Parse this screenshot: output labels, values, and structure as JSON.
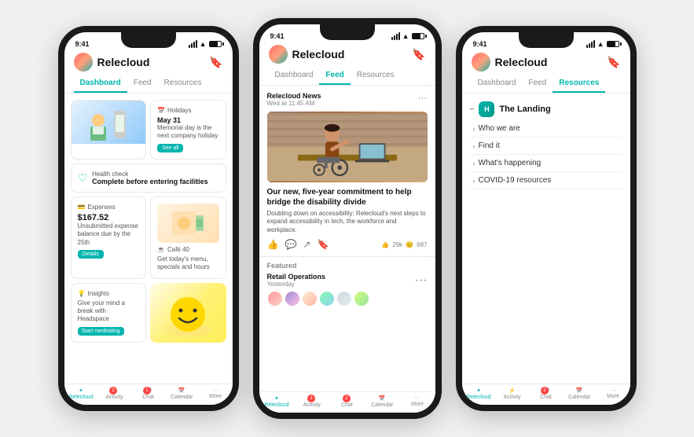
{
  "phones": [
    {
      "id": "dashboard",
      "statusBar": {
        "time": "9:41"
      },
      "header": {
        "title": "Relecloud",
        "bookmarkIcon": "🔖"
      },
      "tabs": [
        {
          "label": "Dashboard",
          "active": true
        },
        {
          "label": "Feed",
          "active": false
        },
        {
          "label": "Resources",
          "active": false
        }
      ],
      "cards": [
        {
          "type": "holiday",
          "label": "Holidays",
          "date": "May 31",
          "title": "Memorial day is the next company holiday",
          "buttonLabel": "See all"
        },
        {
          "type": "health",
          "label": "Health check",
          "title": "Complete before entering facilities"
        },
        {
          "type": "expenses",
          "label": "Expenses",
          "amount": "$167.52",
          "desc": "Unsubmitted expense balance due by the 25th",
          "buttonLabel": "Details"
        },
        {
          "type": "cafe",
          "label": "Café 40",
          "desc": "Get today's menu, specials and hours"
        },
        {
          "type": "insights",
          "label": "Insights",
          "desc": "Give your mind a break with Headspace",
          "buttonLabel": "Start meditating"
        }
      ],
      "bottomNav": [
        {
          "label": "Relecloud",
          "icon": "⚙",
          "active": true,
          "badge": null
        },
        {
          "label": "Activity",
          "icon": "⚡",
          "active": false,
          "badge": "2"
        },
        {
          "label": "Chat",
          "icon": "💬",
          "active": false,
          "badge": "1"
        },
        {
          "label": "Calendar",
          "icon": "📅",
          "active": false,
          "badge": null
        },
        {
          "label": "More",
          "icon": "•••",
          "active": false,
          "badge": null
        }
      ]
    },
    {
      "id": "feed",
      "statusBar": {
        "time": "9:41"
      },
      "header": {
        "title": "Relecloud",
        "bookmarkIcon": "🔖"
      },
      "tabs": [
        {
          "label": "Dashboard",
          "active": false
        },
        {
          "label": "Feed",
          "active": true
        },
        {
          "label": "Resources",
          "active": false
        }
      ],
      "post": {
        "source": "Relecloud News",
        "time": "Wed at 11:45 AM",
        "title": "Our new, five-year commitment to help bridge the disability divide",
        "desc": "Doubling down on accessibility: Relecloud's next steps to expand accessibility in tech, the workforce and workplace.",
        "likes": "29k",
        "comments": "687"
      },
      "featured": {
        "label": "Featured",
        "name": "Retail Operations",
        "time": "Yesterday",
        "avatars": [
          "av1",
          "av2",
          "av3",
          "av4",
          "av5",
          "av6"
        ]
      },
      "bottomNav": [
        {
          "label": "Relecloud",
          "icon": "⚙",
          "active": true,
          "badge": null
        },
        {
          "label": "Activity",
          "icon": "⚡",
          "active": false,
          "badge": "1"
        },
        {
          "label": "Chat",
          "icon": "💬",
          "active": false,
          "badge": "2"
        },
        {
          "label": "Calendar",
          "icon": "📅",
          "active": false,
          "badge": null
        },
        {
          "label": "More",
          "icon": "•••",
          "active": false,
          "badge": null
        }
      ]
    },
    {
      "id": "resources",
      "statusBar": {
        "time": "9:41"
      },
      "header": {
        "title": "Relecloud",
        "bookmarkIcon": "🔖"
      },
      "tabs": [
        {
          "label": "Dashboard",
          "active": false
        },
        {
          "label": "Feed",
          "active": false
        },
        {
          "label": "Resources",
          "active": true
        }
      ],
      "section": {
        "icon": "H",
        "title": "The Landing",
        "items": [
          {
            "label": "Who we are"
          },
          {
            "label": "Find it"
          },
          {
            "label": "What's happening"
          },
          {
            "label": "COVID-19 resources"
          }
        ]
      },
      "bottomNav": [
        {
          "label": "Relecloud",
          "icon": "⚙",
          "active": true,
          "badge": null
        },
        {
          "label": "Activity",
          "icon": "⚡",
          "active": false,
          "badge": null
        },
        {
          "label": "Chat",
          "icon": "💬",
          "active": false,
          "badge": "2"
        },
        {
          "label": "Calendar",
          "icon": "📅",
          "active": false,
          "badge": null
        },
        {
          "label": "More",
          "icon": "•••",
          "active": false,
          "badge": null
        }
      ]
    }
  ]
}
